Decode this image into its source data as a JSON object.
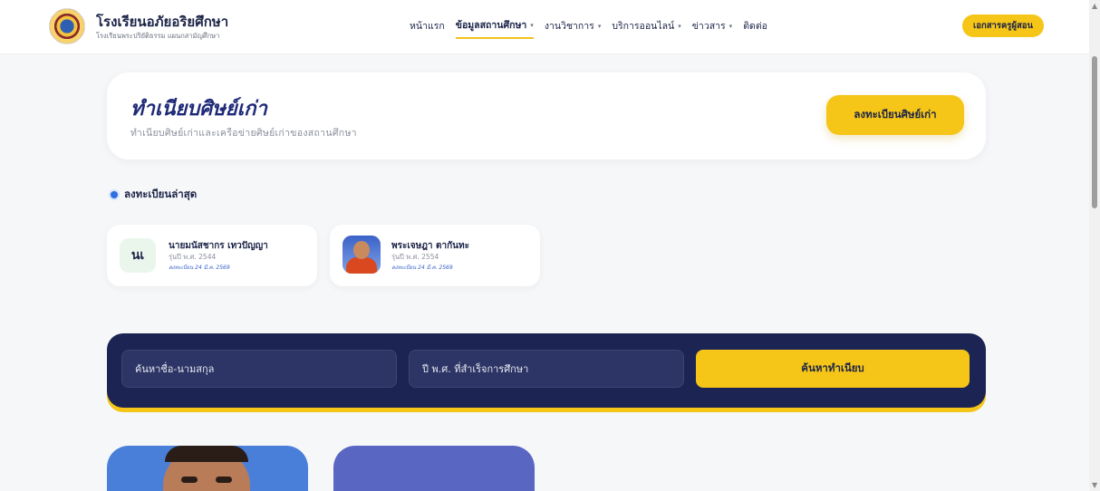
{
  "header": {
    "brand_title": "โรงเรียนอภัยอริยศึกษา",
    "brand_subtitle": "โรงเรียนพระปริยัติธรรม แผนกสามัญศึกษา",
    "nav": [
      {
        "label": "หน้าแรก",
        "has_dropdown": false,
        "active": false
      },
      {
        "label": "ข้อมูลสถานศึกษา",
        "has_dropdown": true,
        "active": true
      },
      {
        "label": "งานวิชาการ",
        "has_dropdown": true,
        "active": false
      },
      {
        "label": "บริการออนไลน์",
        "has_dropdown": true,
        "active": false
      },
      {
        "label": "ข่าวสาร",
        "has_dropdown": true,
        "active": false
      },
      {
        "label": "ติดต่อ",
        "has_dropdown": false,
        "active": false
      }
    ],
    "teacher_button": "เอกสารครูผู้สอน"
  },
  "hero": {
    "title": "ทำเนียบศิษย์เก่า",
    "subtitle": "ทำเนียบศิษย์เก่าและเครือข่ายศิษย์เก่าของสถานศึกษา",
    "register_button": "ลงทะเบียนศิษย์เก่า"
  },
  "recent": {
    "heading": "ลงทะเบียนล่าสุด",
    "items": [
      {
        "initials": "นเ",
        "name": "นายมนัสชากร เทวปัญญา",
        "class_year": "รุ่นปี พ.ศ. 2544",
        "registered": "ลงทะเบียน 24 มี.ค. 2569"
      },
      {
        "initials": "",
        "name": "พระเจษฎา ตากันทะ",
        "class_year": "รุ่นปี พ.ศ. 2554",
        "registered": "ลงทะเบียน 24 มี.ค. 2569"
      }
    ]
  },
  "search": {
    "name_placeholder": "ค้นหาชื่อ-นามสกุล",
    "year_placeholder": "ปี พ.ศ. ที่สำเร็จการศึกษา",
    "button": "ค้นหาทำเนียบ"
  },
  "colors": {
    "accent_yellow": "#f5c518",
    "navy": "#1b2453",
    "title_blue": "#1e2a78"
  }
}
